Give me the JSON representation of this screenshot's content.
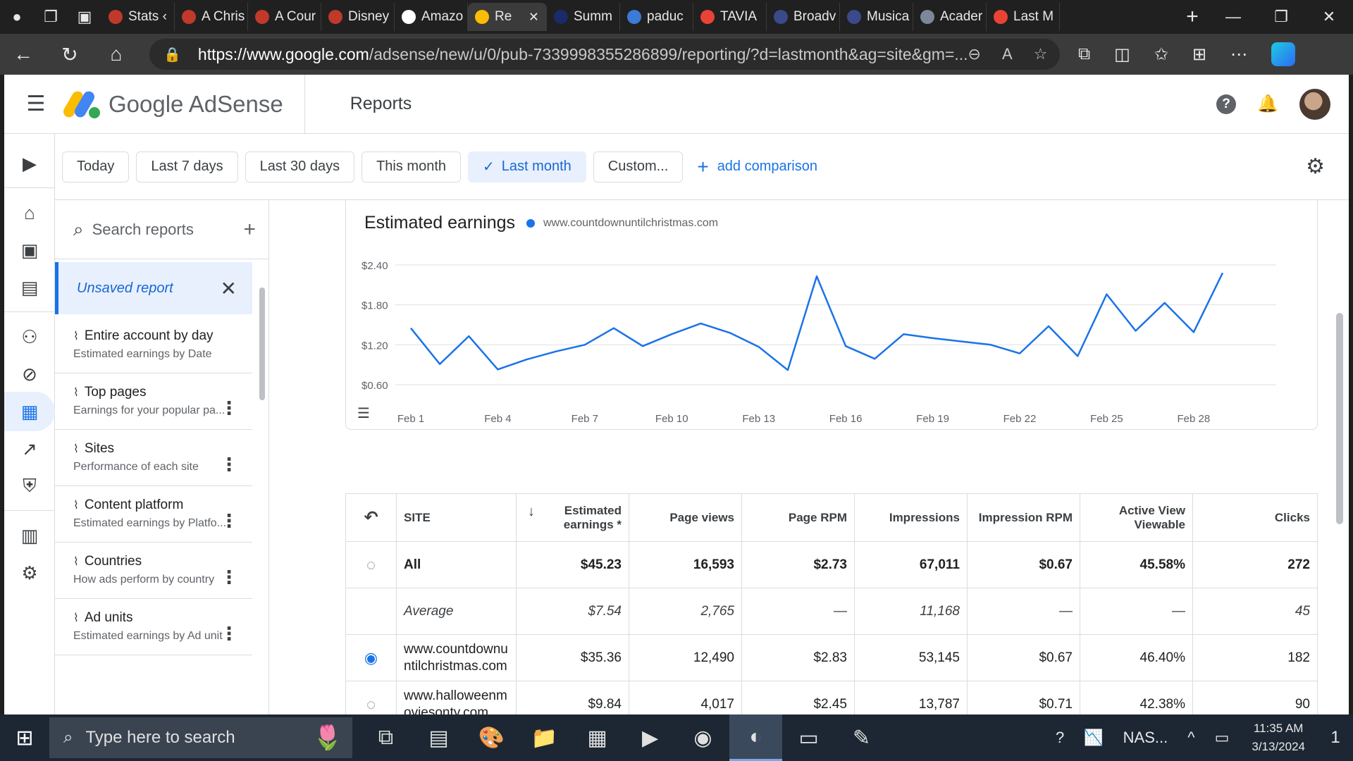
{
  "browser": {
    "tabs": [
      {
        "label": "Stats ‹",
        "icon": "red-shield-icon",
        "color": "#c0392b"
      },
      {
        "label": "A Chris",
        "icon": "red-shield-icon",
        "color": "#c0392b"
      },
      {
        "label": "A Cour",
        "icon": "red-shield-icon",
        "color": "#c0392b"
      },
      {
        "label": "Disney",
        "icon": "red-shield-icon",
        "color": "#c0392b"
      },
      {
        "label": "Amazo",
        "icon": "amazon-icon",
        "color": "#ffffff"
      },
      {
        "label": "Re",
        "icon": "adsense-icon",
        "color": "#fbbc04",
        "active": true
      },
      {
        "label": "Summ",
        "icon": "blue-circle-icon",
        "color": "#1b2a6b"
      },
      {
        "label": "paduc",
        "icon": "cloud-icon",
        "color": "#3a7bd5"
      },
      {
        "label": "TAVIA",
        "icon": "gmail-icon",
        "color": "#ea4335"
      },
      {
        "label": "Broadv",
        "icon": "cloud-icon",
        "color": "#3a4a8a"
      },
      {
        "label": "Musica",
        "icon": "cloud-icon",
        "color": "#3a4a8a"
      },
      {
        "label": "Acader",
        "icon": "document-icon",
        "color": "#7a8899"
      },
      {
        "label": "Last M",
        "icon": "gmail-icon",
        "color": "#ea4335"
      }
    ],
    "url_host": "https://www.google.com",
    "url_path": "/adsense/new/u/0/pub-7339998355286899/reporting/?d=lastmonth&ag=site&gm=..."
  },
  "app": {
    "name": "Google AdSense",
    "page_title": "Reports"
  },
  "date_chips": [
    {
      "label": "Today",
      "selected": false
    },
    {
      "label": "Last 7 days",
      "selected": false
    },
    {
      "label": "Last 30 days",
      "selected": false
    },
    {
      "label": "This month",
      "selected": false
    },
    {
      "label": "Last month",
      "selected": true
    },
    {
      "label": "Custom...",
      "selected": false
    }
  ],
  "add_comparison_label": "add comparison",
  "reports_panel": {
    "search_placeholder": "Search reports",
    "unsaved_label": "Unsaved report",
    "items": [
      {
        "name": "Entire account by day",
        "desc": "Estimated earnings by Date"
      },
      {
        "name": "Top pages",
        "desc": "Earnings for your popular pa..."
      },
      {
        "name": "Sites",
        "desc": "Performance of each site"
      },
      {
        "name": "Content platform",
        "desc": "Estimated earnings by Platfo..."
      },
      {
        "name": "Countries",
        "desc": "How ads perform by country"
      },
      {
        "name": "Ad units",
        "desc": "Estimated earnings by Ad unit"
      }
    ]
  },
  "chart": {
    "title": "Estimated earnings",
    "legend": "www.countdownuntilchristmas.com"
  },
  "chart_data": {
    "type": "line",
    "title": "Estimated earnings",
    "series": [
      {
        "name": "www.countdownuntilchristmas.com",
        "color": "#1a73e8",
        "values": [
          1.45,
          0.91,
          1.33,
          0.83,
          0.98,
          1.1,
          1.2,
          1.45,
          1.18,
          1.36,
          1.52,
          1.38,
          1.17,
          0.82,
          2.23,
          1.18,
          0.99,
          1.36,
          1.3,
          1.25,
          1.2,
          1.07,
          1.48,
          1.03,
          1.96,
          1.41,
          1.83,
          1.39,
          2.28
        ]
      }
    ],
    "x": [
      "Feb 1",
      "Feb 2",
      "Feb 3",
      "Feb 4",
      "Feb 5",
      "Feb 6",
      "Feb 7",
      "Feb 8",
      "Feb 9",
      "Feb 10",
      "Feb 11",
      "Feb 12",
      "Feb 13",
      "Feb 14",
      "Feb 15",
      "Feb 16",
      "Feb 17",
      "Feb 18",
      "Feb 19",
      "Feb 20",
      "Feb 21",
      "Feb 22",
      "Feb 23",
      "Feb 24",
      "Feb 25",
      "Feb 26",
      "Feb 27",
      "Feb 28",
      "Feb 29"
    ],
    "x_tick_labels": [
      "Feb 1",
      "Feb 4",
      "Feb 7",
      "Feb 10",
      "Feb 13",
      "Feb 16",
      "Feb 19",
      "Feb 22",
      "Feb 25",
      "Feb 28"
    ],
    "y_tick_labels": [
      "$0.60",
      "$1.20",
      "$1.80",
      "$2.40"
    ],
    "y_ticks": [
      0.6,
      1.2,
      1.8,
      2.4
    ],
    "ylim": [
      0.6,
      2.4
    ],
    "grid": true
  },
  "table": {
    "columns": [
      "SITE",
      "Estimated earnings *",
      "Page views",
      "Page RPM",
      "Impressions",
      "Impression RPM",
      "Active View Viewable",
      "Clicks"
    ],
    "total": {
      "label": "All",
      "values": [
        "$45.23",
        "16,593",
        "$2.73",
        "67,011",
        "$0.67",
        "45.58%",
        "272"
      ]
    },
    "average": {
      "label": "Average",
      "values": [
        "$7.54",
        "2,765",
        "—",
        "11,168",
        "—",
        "—",
        "45"
      ]
    },
    "rows": [
      {
        "site": "www.countdownuntilchristmas.com",
        "visible": true,
        "values": [
          "$35.36",
          "12,490",
          "$2.83",
          "53,145",
          "$0.67",
          "46.40%",
          "182"
        ]
      },
      {
        "site": "www.halloweenmoviesonty.com",
        "visible": false,
        "values": [
          "$9.84",
          "4,017",
          "$2.45",
          "13,787",
          "$0.71",
          "42.38%",
          "90"
        ]
      }
    ]
  },
  "taskbar": {
    "search_placeholder": "Type here to search",
    "tray_app": "NAS...",
    "time": "11:35 AM",
    "date": "3/13/2024",
    "notification_count": "1"
  }
}
